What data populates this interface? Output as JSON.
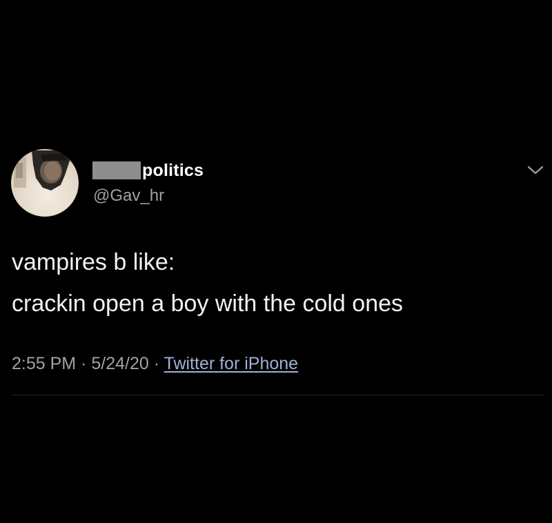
{
  "tweet": {
    "author": {
      "display_name_visible": "politics",
      "display_name_redacted": true,
      "handle": "@Gav_hr",
      "avatar_icon": "profile-photo"
    },
    "menu_icon": "chevron-down-icon",
    "body_lines": [
      "vampires b like:",
      "crackin open a boy with the cold ones"
    ],
    "meta": {
      "time": "2:55 PM",
      "separator": "·",
      "date": "5/24/20",
      "source": "Twitter for iPhone"
    }
  },
  "colors": {
    "background": "#000000",
    "primary_text": "#ffffff",
    "secondary_text": "#9ea3a8",
    "link": "#9fb1d6",
    "redaction": "#8e8e8e",
    "divider": "#262626"
  }
}
